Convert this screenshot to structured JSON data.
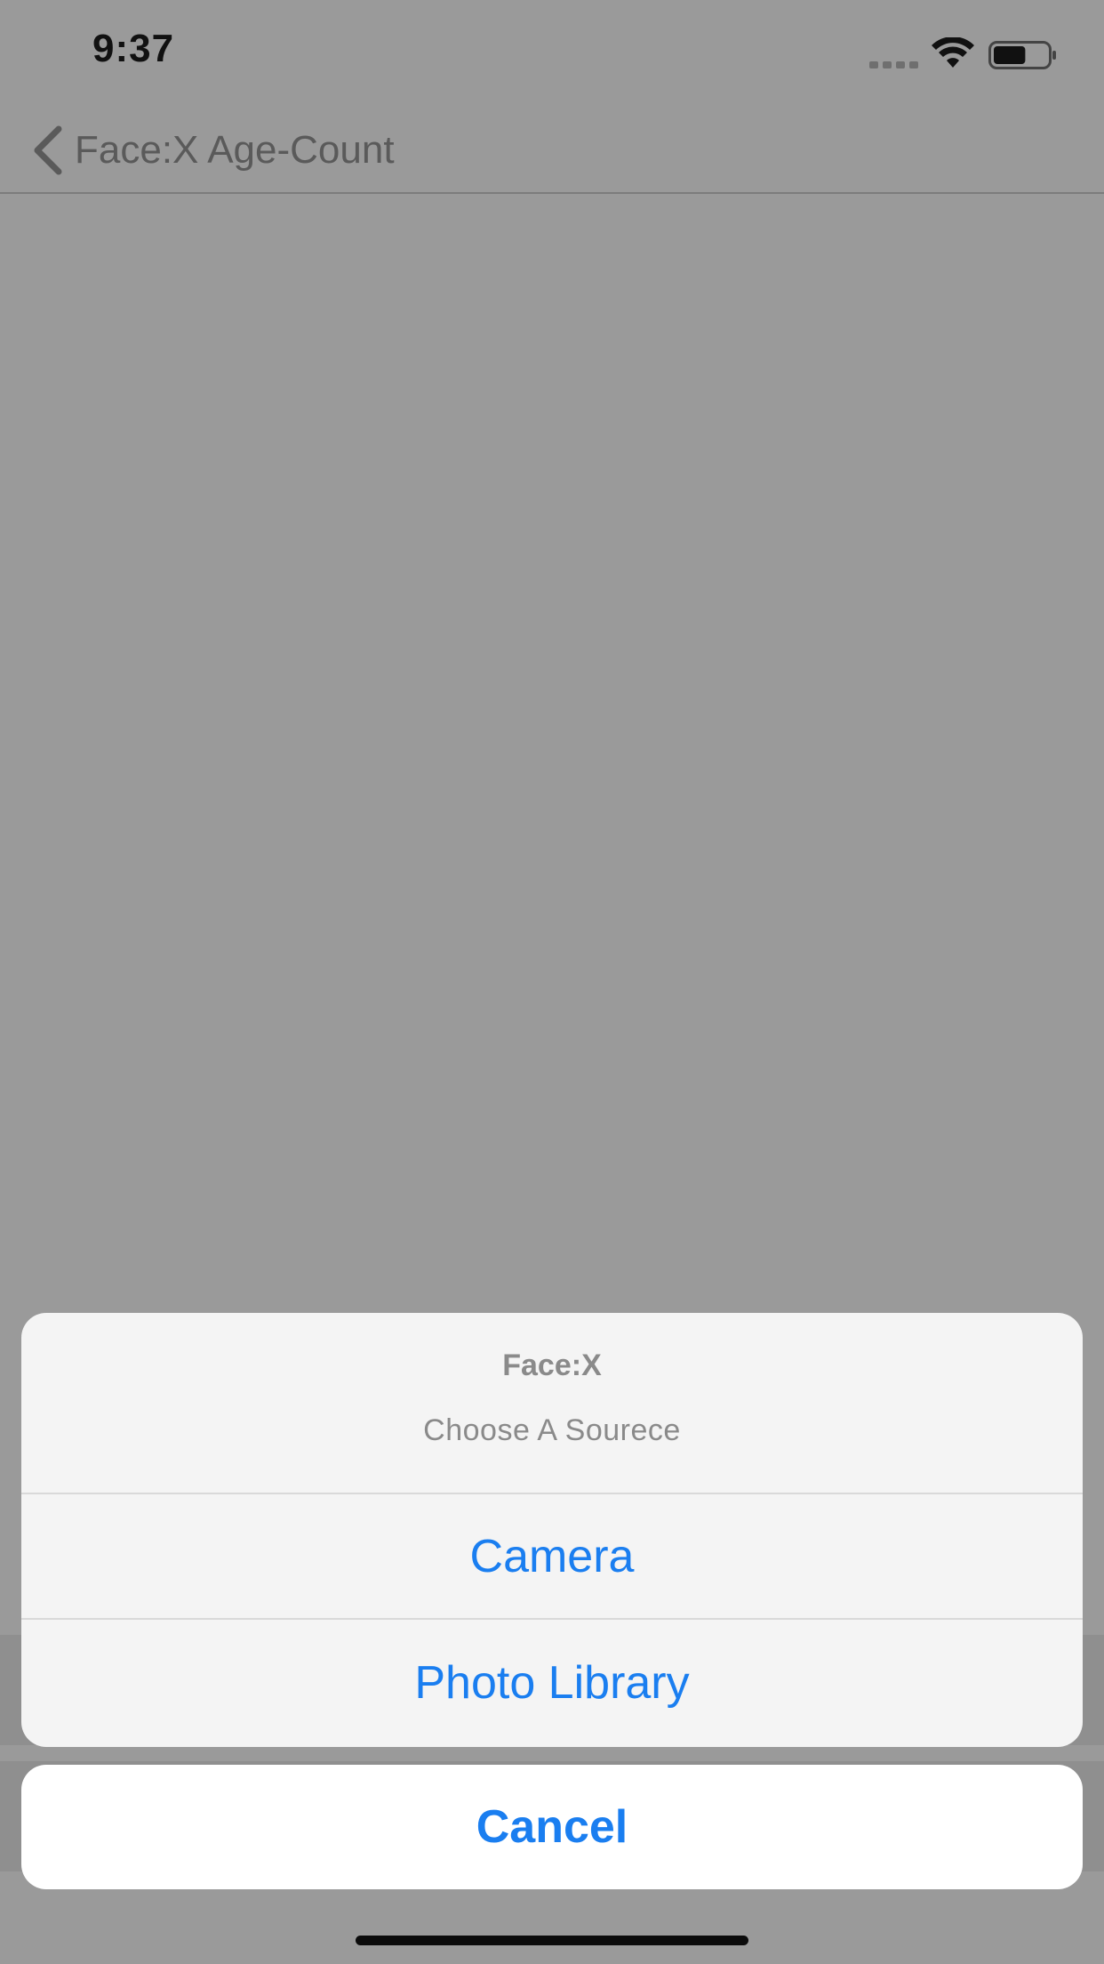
{
  "status_bar": {
    "time": "9:37",
    "signal_icon": "signal-dots-icon",
    "wifi_icon": "wifi-icon",
    "battery_icon": "battery-icon",
    "battery_level": 0.6
  },
  "nav_bar": {
    "back_icon": "chevron-left-icon",
    "back_label": "Face:X Age-Count"
  },
  "action_sheet": {
    "title": "Face:X",
    "message": "Choose A Sourece",
    "options": [
      {
        "label": "Camera"
      },
      {
        "label": "Photo Library"
      }
    ],
    "cancel_label": "Cancel"
  },
  "colors": {
    "accent": "#1a7ef0",
    "dim_background": "#9a9a9a",
    "sheet_background": "#f4f4f4"
  }
}
